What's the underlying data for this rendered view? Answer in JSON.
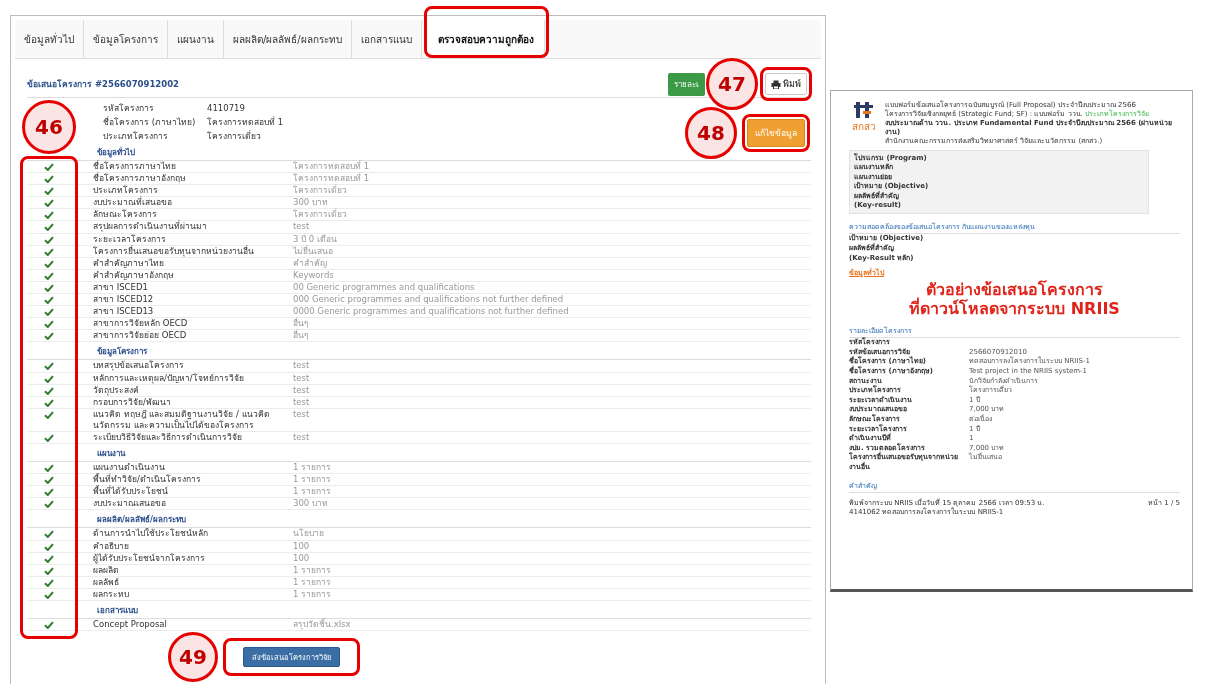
{
  "tabs": [
    {
      "label": "ข้อมูลทั่วไป",
      "selected": false
    },
    {
      "label": "ข้อมูลโครงการ",
      "selected": false
    },
    {
      "label": "แผนงาน",
      "selected": false
    },
    {
      "label": "ผลผลิต/ผลลัพธ์/ผลกระทบ",
      "selected": false
    },
    {
      "label": "เอกสารแนบ",
      "selected": false
    },
    {
      "label": "ตรวจสอบความถูกต้อง",
      "selected": true
    }
  ],
  "header": {
    "title": "ข้อเสนอโครงการ #2566070912002",
    "details_button": "รายละเ",
    "print_button": "พิมพ์",
    "edit_button": "แก้ไขข้อมูล"
  },
  "summary": [
    {
      "label": "รหัสโครงการ",
      "value": "4110719"
    },
    {
      "label": "ชื่อโครงการ (ภาษาไทย)",
      "value": "โครงการทดสอบที่ 1"
    },
    {
      "label": "ประเภทโครงการ",
      "value": "โครงการเดี่ยว"
    }
  ],
  "sections": [
    {
      "title": "ข้อมูลทั่วไป",
      "items": [
        {
          "passed": true,
          "label": "ชื่อโครงการภาษาไทย",
          "value": "โครงการทดสอบที่ 1"
        },
        {
          "passed": true,
          "label": "ชื่อโครงการภาษาอังกฤษ",
          "value": "โครงการทดสอบที่ 1"
        },
        {
          "passed": true,
          "label": "ประเภทโครงการ",
          "value": "โครงการเดี่ยว"
        },
        {
          "passed": true,
          "label": "งบประมาณที่เสนอขอ",
          "value": "300 บาท"
        },
        {
          "passed": true,
          "label": "ลักษณะโครงการ",
          "value": "โครงการเดี่ยว"
        },
        {
          "passed": true,
          "label": "สรุปผลการดำเนินงานที่ผ่านมา",
          "value": "test"
        },
        {
          "passed": true,
          "label": "ระยะเวลาโครงการ",
          "value": "3 ปี 0 เดือน"
        },
        {
          "passed": true,
          "label": "โครงการยื่นเสนอขอรับทุนจากหน่วยงานอื่น",
          "value": "ไม่ยื่นเสนอ"
        },
        {
          "passed": true,
          "label": "คำสำคัญภาษาไทย",
          "value": "คำสำคัญ"
        },
        {
          "passed": true,
          "label": "คำสำคัญภาษาอังกฤษ",
          "value": "Keywords"
        },
        {
          "passed": true,
          "label": "สาขา ISCED1",
          "value": "00 Generic programmes and qualifications"
        },
        {
          "passed": true,
          "label": "สาขา ISCED12",
          "value": "000 Generic programmes and qualifications not further defined"
        },
        {
          "passed": true,
          "label": "สาขา ISCED13",
          "value": "0000 Generic programmes and qualifications not further defined"
        },
        {
          "passed": true,
          "label": "สาขาการวิจัยหลัก OECD",
          "value": "อื่นๆ"
        },
        {
          "passed": true,
          "label": "สาขาการวิจัยย่อย OECD",
          "value": "อื่นๆ"
        }
      ]
    },
    {
      "title": "ข้อมูลโครงการ",
      "items": [
        {
          "passed": true,
          "label": "บทสรุปข้อเสนอโครงการ",
          "value": "test"
        },
        {
          "passed": true,
          "label": "หลักการและเหตุผล/ปัญหา/โจทย์การวิจัย",
          "value": "test"
        },
        {
          "passed": true,
          "label": "วัตถุประสงค์",
          "value": "test"
        },
        {
          "passed": true,
          "label": "กรอบการวิจัย/พัฒนา",
          "value": "test"
        },
        {
          "passed": true,
          "label": "แนวคิด ทฤษฎี และสมมติฐานงานวิจัย / แนวคิดนวัตกรรม และความเป็นไปได้ของโครงการ",
          "value": "test"
        },
        {
          "passed": true,
          "label": "ระเบียบวิธีวิจัยและวิธีการดำเนินการวิจัย",
          "value": "test"
        }
      ]
    },
    {
      "title": "แผนงาน",
      "items": [
        {
          "passed": true,
          "label": "แผนงานดำเนินงาน",
          "value": "1 รายการ"
        },
        {
          "passed": true,
          "label": "พื้นที่ทำวิจัย/ดำเนินโครงการ",
          "value": "1 รายการ"
        },
        {
          "passed": true,
          "label": "พื้นที่ได้รับประโยชน์",
          "value": "1 รายการ"
        },
        {
          "passed": true,
          "label": "งบประมาณเสนอขอ",
          "value": "300 บาท"
        }
      ]
    },
    {
      "title": "ผลผลิต/ผลลัพธ์/ผลกระทบ",
      "items": [
        {
          "passed": true,
          "label": "ด้านการนำไปใช้ประโยชน์หลัก",
          "value": "นโยบาย"
        },
        {
          "passed": true,
          "label": "คำอธิบาย",
          "value": "100"
        },
        {
          "passed": true,
          "label": "ผู้ได้รับประโยชน์จากโครงการ",
          "value": "100"
        },
        {
          "passed": true,
          "label": "ผลผลิต",
          "value": "1 รายการ"
        },
        {
          "passed": true,
          "label": "ผลลัพธ์",
          "value": "1 รายการ"
        },
        {
          "passed": true,
          "label": "ผลกระทบ",
          "value": "1 รายการ"
        }
      ]
    },
    {
      "title": "เอกสารแนบ",
      "items": [
        {
          "passed": true,
          "label": "Concept Proposal",
          "value": "สรุปวัดชิ้น.xlsx"
        }
      ]
    }
  ],
  "submit_button": "ส่งข้อเสนอโครงการวิจัย",
  "document": {
    "logo_text": "สกสว",
    "heading_lines": [
      "แบบฟอร์มข้อเสนอโครงการฉบับสมบูรณ์ (Full Proposal) ประจำปีงบประมาณ 2566",
      "โครงการวิจัยเชิงกลยุทธ์ (Strategic Fund; SF) : แบบฟอร์ม ววน.",
      "งบประมาณด้าน ววน. ประเภท Fundamental Fund ประจำปีงบประมาณ 2566 (ผ่านหน่วยงาน)",
      "สำนักงานคณะกรรมการส่งเสริมวิทยาศาสตร์ วิจัยและนวัตกรรม (สกสว.)"
    ],
    "program_type_link": "ประเภทโครงการวิจัย",
    "program_box": [
      "โปรแกรม (Program)",
      "แผนงานหลัก",
      "แผนงานย่อย",
      "เป้าหมาย (Objective)",
      "ผลลัพธ์ที่สำคัญ",
      "(Key-result)"
    ],
    "alignment_title": "ความสอดคล้องของข้อเสนอโครงการ กับแผนงานของแหล่งทุน",
    "alignment_items": [
      "เป้าหมาย (Objective)",
      "ผลลัพธ์ที่สำคัญ",
      "(Key-Result หลัก)"
    ],
    "general_link": "ข้อมูลทั่วไป",
    "details_title": "รายละเอียดโครงการ",
    "details": [
      {
        "label": "รหัสโครงการ"
      },
      {
        "label": "รหัสข้อเสนอการวิจัย",
        "value": "2566070912010"
      },
      {
        "label": "ชื่อโครงการ (ภาษาไทย)",
        "value": "ทดสอบการลงโครงการในระบบ NRIIS-1"
      },
      {
        "label": "ชื่อโครงการ (ภาษาอังกฤษ)",
        "value": "Test project in the NRIIS system-1"
      },
      {
        "label": "สถานะงาน",
        "value": "นักวิจัยกำลังดำเนินการ"
      },
      {
        "label": "ประเภทโครงการ",
        "value": "โครงการเดี่ยว"
      },
      {
        "label": "ระยะเวลาดำเนินงาน",
        "value": "1 ปี"
      },
      {
        "label": "งบประมาณเสนอขอ",
        "value": "7,000 บาท"
      },
      {
        "label": "ลักษณะโครงการ",
        "value": "ต่อเนื่อง"
      },
      {
        "label": "ระยะเวลาโครงการ",
        "value": "1 ปี"
      },
      {
        "label": "ดำเนินงานปีที่",
        "value": "1"
      },
      {
        "label": "งปม. รวมตลอดโครงการ",
        "value": "7,000 บาท"
      },
      {
        "label": "โครงการยื่นเสนอขอรับทุนจากหน่วยงานอื่น",
        "value": "ไม่ยื่นเสนอ"
      }
    ],
    "keywords_title": "คำสำคัญ",
    "footer_lines": [
      "พิมพ์จากระบบ NRIIS เมื่อวันที่ 15 ตุลาคม 2566 เวลา 09:53 น.",
      "4141062 ทดสอบการลงโครงการในระบบ NRIIS-1"
    ],
    "page_number": "หน้า 1 / 5"
  },
  "overlay_text": [
    "ตัวอย่างข้อเสนอโครงการ",
    "ที่ดาวน์โหลดจากระบบ NRIIS"
  ],
  "callouts": [
    "46",
    "47",
    "48",
    "49"
  ]
}
